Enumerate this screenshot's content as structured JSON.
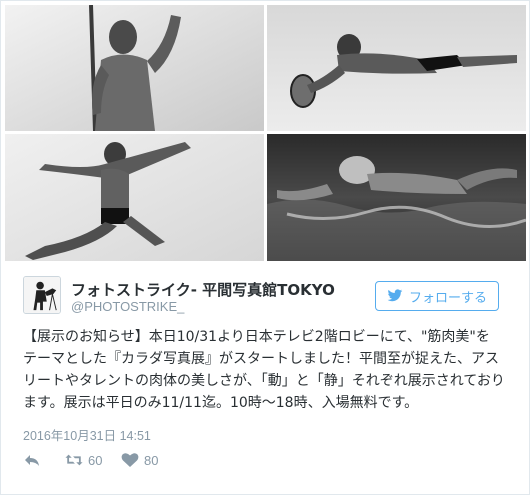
{
  "profile": {
    "display_name": "フォトストライク- 平間写真館TOKYO",
    "handle": "@PHOTOSTRIKE_"
  },
  "follow_button": {
    "label": "フォローする",
    "icon": "twitter-bird-icon"
  },
  "tweet": {
    "lines": [
      "【展示のお知らせ】本日10/31より日本テレビ2階ロビーにて、\"筋肉美\"を",
      "テーマとした『カラダ写真展』がスタートしました！平間至が捉えた、アス",
      "リートやタレントの肉体の美しさが、「動」と「静」それぞれ展示されており",
      "ます。展示は平日のみ11/11迄。10時〜18時、入場無料です。"
    ],
    "timestamp": "2016年10月31日 14:51"
  },
  "actions": {
    "reply_icon": "reply-icon",
    "retweet_count": "60",
    "like_count": "80"
  },
  "photos": [
    "javelin-athlete-photo",
    "rugby-dive-photo",
    "sprinter-leap-photo",
    "swimmer-butterfly-photo"
  ],
  "colors": {
    "accent": "#55acee",
    "muted": "#8899a6",
    "text": "#292f33",
    "border": "#e1e8ed"
  }
}
